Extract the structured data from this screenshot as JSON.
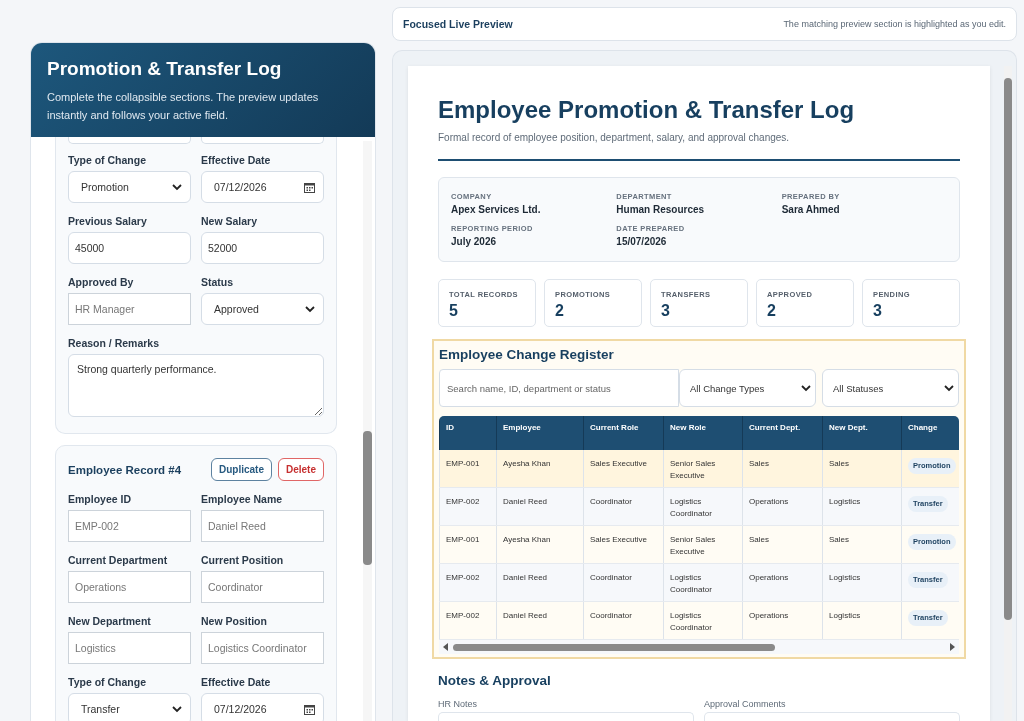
{
  "editor": {
    "title": "Promotion & Transfer Log",
    "subtitle": "Complete the collapsible sections. The preview updates instantly and follows your active field.",
    "records": [
      {
        "cut_top": true,
        "fields": [
          {
            "label": "Type of Change",
            "kind": "select",
            "value": "Promotion"
          },
          {
            "label": "Effective Date",
            "kind": "date",
            "value": "07/12/2026"
          },
          {
            "label": "Previous Salary",
            "kind": "text",
            "value": "45000"
          },
          {
            "label": "New Salary",
            "kind": "text",
            "value": "52000"
          },
          {
            "label": "Approved By",
            "kind": "text",
            "placeholder": "HR Manager"
          },
          {
            "label": "Status",
            "kind": "select",
            "value": "Approved"
          },
          {
            "label": "Reason / Remarks",
            "kind": "textarea",
            "value": "Strong quarterly performance."
          }
        ]
      },
      {
        "title": "Employee Record #4",
        "cut_top": false,
        "buttons": [
          {
            "label": "Duplicate",
            "kind": "neutral"
          },
          {
            "label": "Delete",
            "kind": "danger"
          }
        ],
        "fields": [
          {
            "label": "Employee ID",
            "kind": "text",
            "placeholder": "EMP-002"
          },
          {
            "label": "Employee Name",
            "kind": "text",
            "placeholder": "Daniel Reed"
          },
          {
            "label": "Current Department",
            "kind": "text",
            "placeholder": "Operations"
          },
          {
            "label": "Current Position",
            "kind": "text",
            "placeholder": "Coordinator"
          },
          {
            "label": "New Department",
            "kind": "text",
            "placeholder": "Logistics"
          },
          {
            "label": "New Position",
            "kind": "text",
            "placeholder": "Logistics Coordinator"
          },
          {
            "label": "Type of Change",
            "kind": "select",
            "value": "Transfer"
          },
          {
            "label": "Effective Date",
            "kind": "date",
            "value": "07/12/2026"
          }
        ]
      }
    ]
  },
  "preview_bar": {
    "title": "Focused Live Preview",
    "hint": "The matching preview section is highlighted as you edit."
  },
  "document": {
    "title": "Employee Promotion & Transfer Log",
    "subtitle": "Formal record of employee position, department, salary, and approval changes.",
    "info": [
      {
        "label": "COMPANY",
        "value": "Apex Services Ltd."
      },
      {
        "label": "DEPARTMENT",
        "value": "Human Resources"
      },
      {
        "label": "PREPARED BY",
        "value": "Sara Ahmed"
      },
      {
        "label": "REPORTING PERIOD",
        "value": "July 2026"
      },
      {
        "label": "DATE PREPARED",
        "value": "15/07/2026"
      }
    ],
    "stats": [
      {
        "label": "TOTAL RECORDS",
        "value": "5"
      },
      {
        "label": "PROMOTIONS",
        "value": "2"
      },
      {
        "label": "TRANSFERS",
        "value": "3"
      },
      {
        "label": "APPROVED",
        "value": "2"
      },
      {
        "label": "PENDING",
        "value": "3"
      }
    ],
    "register": {
      "title": "Employee Change Register",
      "highlighted": true,
      "search_placeholder": "Search name, ID, department or status",
      "filters": [
        "All Change Types",
        "All Statuses"
      ],
      "columns": [
        "ID",
        "Employee",
        "Current Role",
        "New Role",
        "Current Dept.",
        "New Dept.",
        "Change"
      ],
      "rows": [
        {
          "cells": [
            "EMP-001",
            "Ayesha Khan",
            "Sales Executive",
            "Senior Sales Executive",
            "Sales",
            "Sales",
            "Promotion"
          ],
          "selected": true
        },
        {
          "cells": [
            "EMP-002",
            "Daniel Reed",
            "Coordinator",
            "Logistics Coordinator",
            "Operations",
            "Logistics",
            "Transfer"
          ],
          "selected": false
        },
        {
          "cells": [
            "EMP-001",
            "Ayesha Khan",
            "Sales Executive",
            "Senior Sales Executive",
            "Sales",
            "Sales",
            "Promotion"
          ],
          "selected": false
        },
        {
          "cells": [
            "EMP-002",
            "Daniel Reed",
            "Coordinator",
            "Logistics Coordinator",
            "Operations",
            "Logistics",
            "Transfer"
          ],
          "selected": false
        },
        {
          "cells": [
            "EMP-002",
            "Daniel Reed",
            "Coordinator",
            "Logistics Coordinator",
            "Operations",
            "Logistics",
            "Transfer"
          ],
          "selected": false
        }
      ]
    },
    "notes": {
      "title": "Notes & Approval",
      "labels": [
        "HR Notes",
        "Approval Comments"
      ]
    }
  }
}
